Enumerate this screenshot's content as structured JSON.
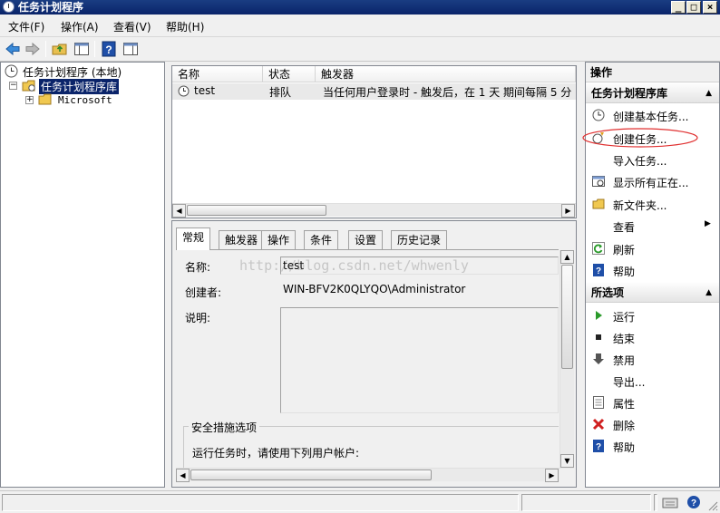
{
  "window": {
    "title": "任务计划程序",
    "controls": [
      "_",
      "□",
      "×"
    ]
  },
  "menu": [
    "文件(F)",
    "操作(A)",
    "查看(V)",
    "帮助(H)"
  ],
  "toolbar": {
    "icons": [
      "back-icon",
      "forward-icon",
      "up-folder-icon",
      "show-hide-tree-icon",
      "help-icon",
      "show-hide-action-pane-icon"
    ]
  },
  "tree": {
    "root": "任务计划程序 (本地)",
    "library": "任务计划程序库",
    "child": "Microsoft",
    "expand_minus": "−",
    "expand_plus": "+"
  },
  "task_list": {
    "columns": [
      "名称",
      "状态",
      "触发器"
    ],
    "rows": [
      {
        "name": "test",
        "status": "排队",
        "trigger": "当任何用户登录时 - 触发后，在 1 天 期间每隔 5 分"
      }
    ]
  },
  "detail": {
    "tabs": [
      "常规",
      "触发器",
      "操作",
      "条件",
      "设置",
      "历史记录"
    ],
    "active_tab": "常规",
    "name_label": "名称:",
    "name_value": "test",
    "author_label": "创建者:",
    "author_value": "WIN-BFV2K0QLYQO\\Administrator",
    "description_label": "说明:",
    "security_group": "安全措施选项",
    "run_as_text": "运行任务时，请使用下列用户帐户:"
  },
  "watermark": "http://blog.csdn.net/whwenly",
  "actions": {
    "header": "操作",
    "section1_title": "任务计划程序库",
    "section1_items": [
      {
        "label": "创建基本任务...",
        "icon": "create-basic-task-icon"
      },
      {
        "label": "创建任务...",
        "icon": "create-task-icon"
      },
      {
        "label": "导入任务...",
        "icon": ""
      },
      {
        "label": "显示所有正在...",
        "icon": "running-tasks-icon"
      },
      {
        "label": "新文件夹...",
        "icon": "new-folder-icon"
      },
      {
        "label": "查看",
        "icon": ""
      },
      {
        "label": "刷新",
        "icon": "refresh-icon"
      },
      {
        "label": "帮助",
        "icon": "help-icon"
      }
    ],
    "section2_title": "所选项",
    "section2_items": [
      {
        "label": "运行",
        "icon": "run-icon"
      },
      {
        "label": "结束",
        "icon": "stop-icon"
      },
      {
        "label": "禁用",
        "icon": "disable-icon"
      },
      {
        "label": "导出...",
        "icon": ""
      },
      {
        "label": "属性",
        "icon": "properties-icon"
      },
      {
        "label": "删除",
        "icon": "delete-icon"
      },
      {
        "label": "帮助",
        "icon": "help-icon"
      }
    ]
  },
  "colors": {
    "titlebar": "#0a246a",
    "selection": "#0a246a",
    "annotation_circle": "#e03030",
    "help_icon": "#1f4fa8",
    "run_icon": "#2a9a2a",
    "delete_icon": "#d02020"
  }
}
